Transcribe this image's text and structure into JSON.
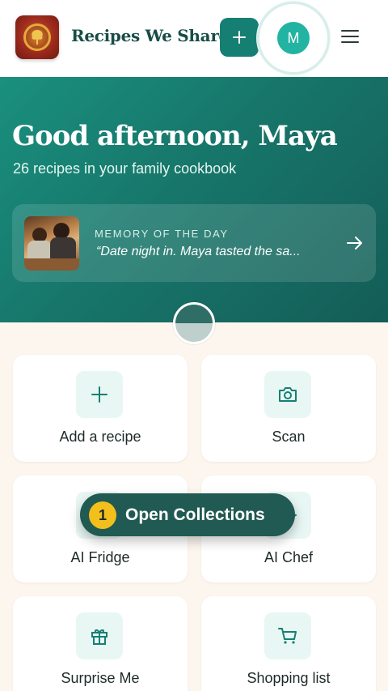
{
  "header": {
    "brand": "Recipes We Share",
    "avatar_initial": "M"
  },
  "hero": {
    "greeting": "Good afternoon, Maya",
    "subtitle": "26 recipes in your family cookbook",
    "memory": {
      "label": "MEMORY OF THE DAY",
      "quote": "“Date night in. Maya tasted the sa..."
    }
  },
  "actions": [
    {
      "label": "Add a recipe",
      "icon": "plus-icon"
    },
    {
      "label": "Scan",
      "icon": "camera-icon"
    },
    {
      "label": "AI Fridge",
      "icon": "fridge-icon"
    },
    {
      "label": "AI Chef",
      "icon": "sparkle-icon"
    },
    {
      "label": "Surprise Me",
      "icon": "gift-icon"
    },
    {
      "label": "Shopping list",
      "icon": "cart-icon"
    }
  ],
  "tooltip": {
    "step": "1",
    "text": "Open Collections"
  },
  "colors": {
    "brand": "#167f73",
    "hero_start": "#1a907f",
    "hero_end": "#145d57",
    "step_badge": "#f3bf1c",
    "background": "#fdf6ef"
  }
}
